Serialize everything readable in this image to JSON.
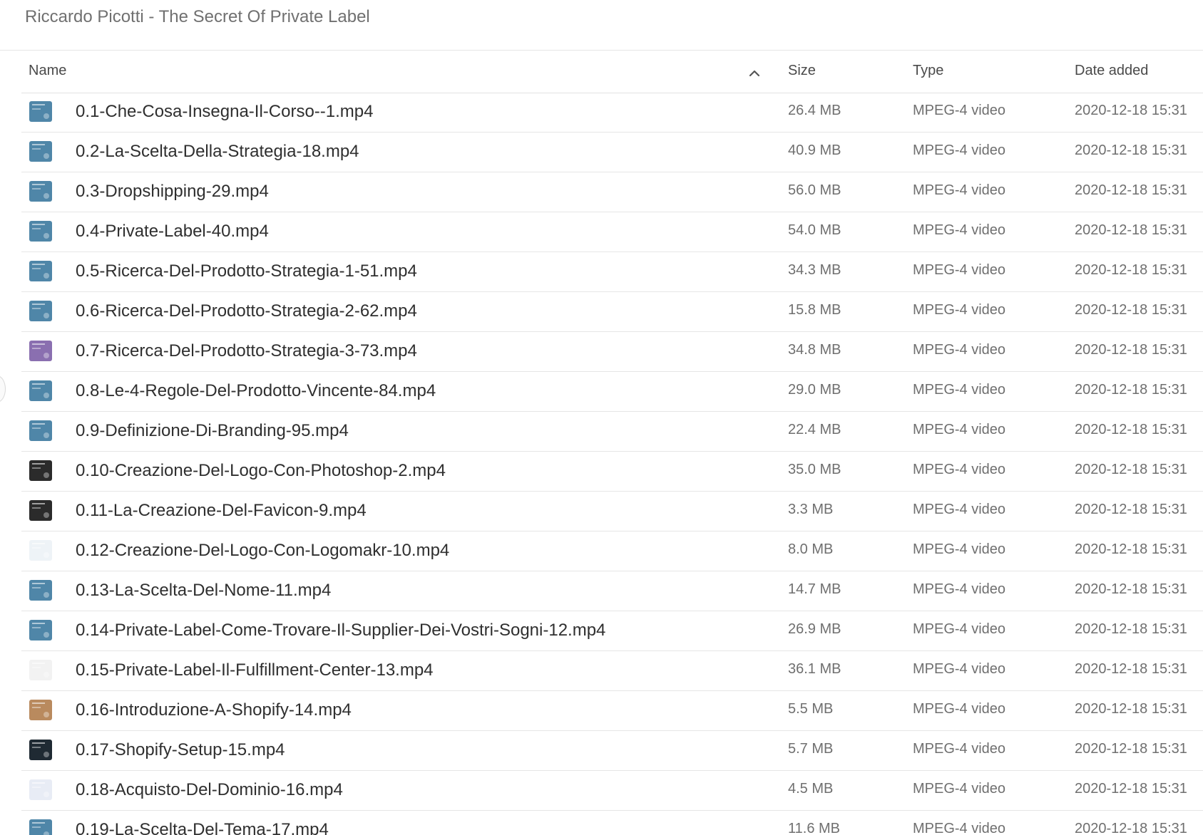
{
  "title": "Riccardo Picotti - The Secret Of Private Label",
  "columns": {
    "name": "Name",
    "size": "Size",
    "type": "Type",
    "date": "Date added"
  },
  "rows": [
    {
      "name": "0.1-Che-Cosa-Insegna-Il-Corso--1.mp4",
      "size": "26.4 MB",
      "type": "MPEG-4 video",
      "date": "2020-12-18 15:31",
      "thumb": "#4f86a8"
    },
    {
      "name": "0.2-La-Scelta-Della-Strategia-18.mp4",
      "size": "40.9 MB",
      "type": "MPEG-4 video",
      "date": "2020-12-18 15:31",
      "thumb": "#4f86a8"
    },
    {
      "name": "0.3-Dropshipping-29.mp4",
      "size": "56.0 MB",
      "type": "MPEG-4 video",
      "date": "2020-12-18 15:31",
      "thumb": "#4f86a8"
    },
    {
      "name": "0.4-Private-Label-40.mp4",
      "size": "54.0 MB",
      "type": "MPEG-4 video",
      "date": "2020-12-18 15:31",
      "thumb": "#4f86a8"
    },
    {
      "name": "0.5-Ricerca-Del-Prodotto-Strategia-1-51.mp4",
      "size": "34.3 MB",
      "type": "MPEG-4 video",
      "date": "2020-12-18 15:31",
      "thumb": "#4f86a8"
    },
    {
      "name": "0.6-Ricerca-Del-Prodotto-Strategia-2-62.mp4",
      "size": "15.8 MB",
      "type": "MPEG-4 video",
      "date": "2020-12-18 15:31",
      "thumb": "#4f86a8"
    },
    {
      "name": "0.7-Ricerca-Del-Prodotto-Strategia-3-73.mp4",
      "size": "34.8 MB",
      "type": "MPEG-4 video",
      "date": "2020-12-18 15:31",
      "thumb": "#8a6fb0"
    },
    {
      "name": "0.8-Le-4-Regole-Del-Prodotto-Vincente-84.mp4",
      "size": "29.0 MB",
      "type": "MPEG-4 video",
      "date": "2020-12-18 15:31",
      "thumb": "#4f86a8"
    },
    {
      "name": "0.9-Definizione-Di-Branding-95.mp4",
      "size": "22.4 MB",
      "type": "MPEG-4 video",
      "date": "2020-12-18 15:31",
      "thumb": "#4f86a8"
    },
    {
      "name": "0.10-Creazione-Del-Logo-Con-Photoshop-2.mp4",
      "size": "35.0 MB",
      "type": "MPEG-4 video",
      "date": "2020-12-18 15:31",
      "thumb": "#2b2b2b"
    },
    {
      "name": "0.11-La-Creazione-Del-Favicon-9.mp4",
      "size": "3.3 MB",
      "type": "MPEG-4 video",
      "date": "2020-12-18 15:31",
      "thumb": "#2b2b2b"
    },
    {
      "name": "0.12-Creazione-Del-Logo-Con-Logomakr-10.mp4",
      "size": "8.0 MB",
      "type": "MPEG-4 video",
      "date": "2020-12-18 15:31",
      "thumb": "#eef3f7"
    },
    {
      "name": "0.13-La-Scelta-Del-Nome-11.mp4",
      "size": "14.7 MB",
      "type": "MPEG-4 video",
      "date": "2020-12-18 15:31",
      "thumb": "#4f86a8"
    },
    {
      "name": "0.14-Private-Label-Come-Trovare-Il-Supplier-Dei-Vostri-Sogni-12.mp4",
      "size": "26.9 MB",
      "type": "MPEG-4 video",
      "date": "2020-12-18 15:31",
      "thumb": "#4f86a8"
    },
    {
      "name": "0.15-Private-Label-Il-Fulfillment-Center-13.mp4",
      "size": "36.1 MB",
      "type": "MPEG-4 video",
      "date": "2020-12-18 15:31",
      "thumb": "#f2f2f2"
    },
    {
      "name": "0.16-Introduzione-A-Shopify-14.mp4",
      "size": "5.5 MB",
      "type": "MPEG-4 video",
      "date": "2020-12-18 15:31",
      "thumb": "#b98a5e"
    },
    {
      "name": "0.17-Shopify-Setup-15.mp4",
      "size": "5.7 MB",
      "type": "MPEG-4 video",
      "date": "2020-12-18 15:31",
      "thumb": "#1f2a33"
    },
    {
      "name": "0.18-Acquisto-Del-Dominio-16.mp4",
      "size": "4.5 MB",
      "type": "MPEG-4 video",
      "date": "2020-12-18 15:31",
      "thumb": "#e8ecf5"
    },
    {
      "name": "0.19-La-Scelta-Del-Tema-17.mp4",
      "size": "11.6 MB",
      "type": "MPEG-4 video",
      "date": "2020-12-18 15:31",
      "thumb": "#4f86a8"
    }
  ]
}
